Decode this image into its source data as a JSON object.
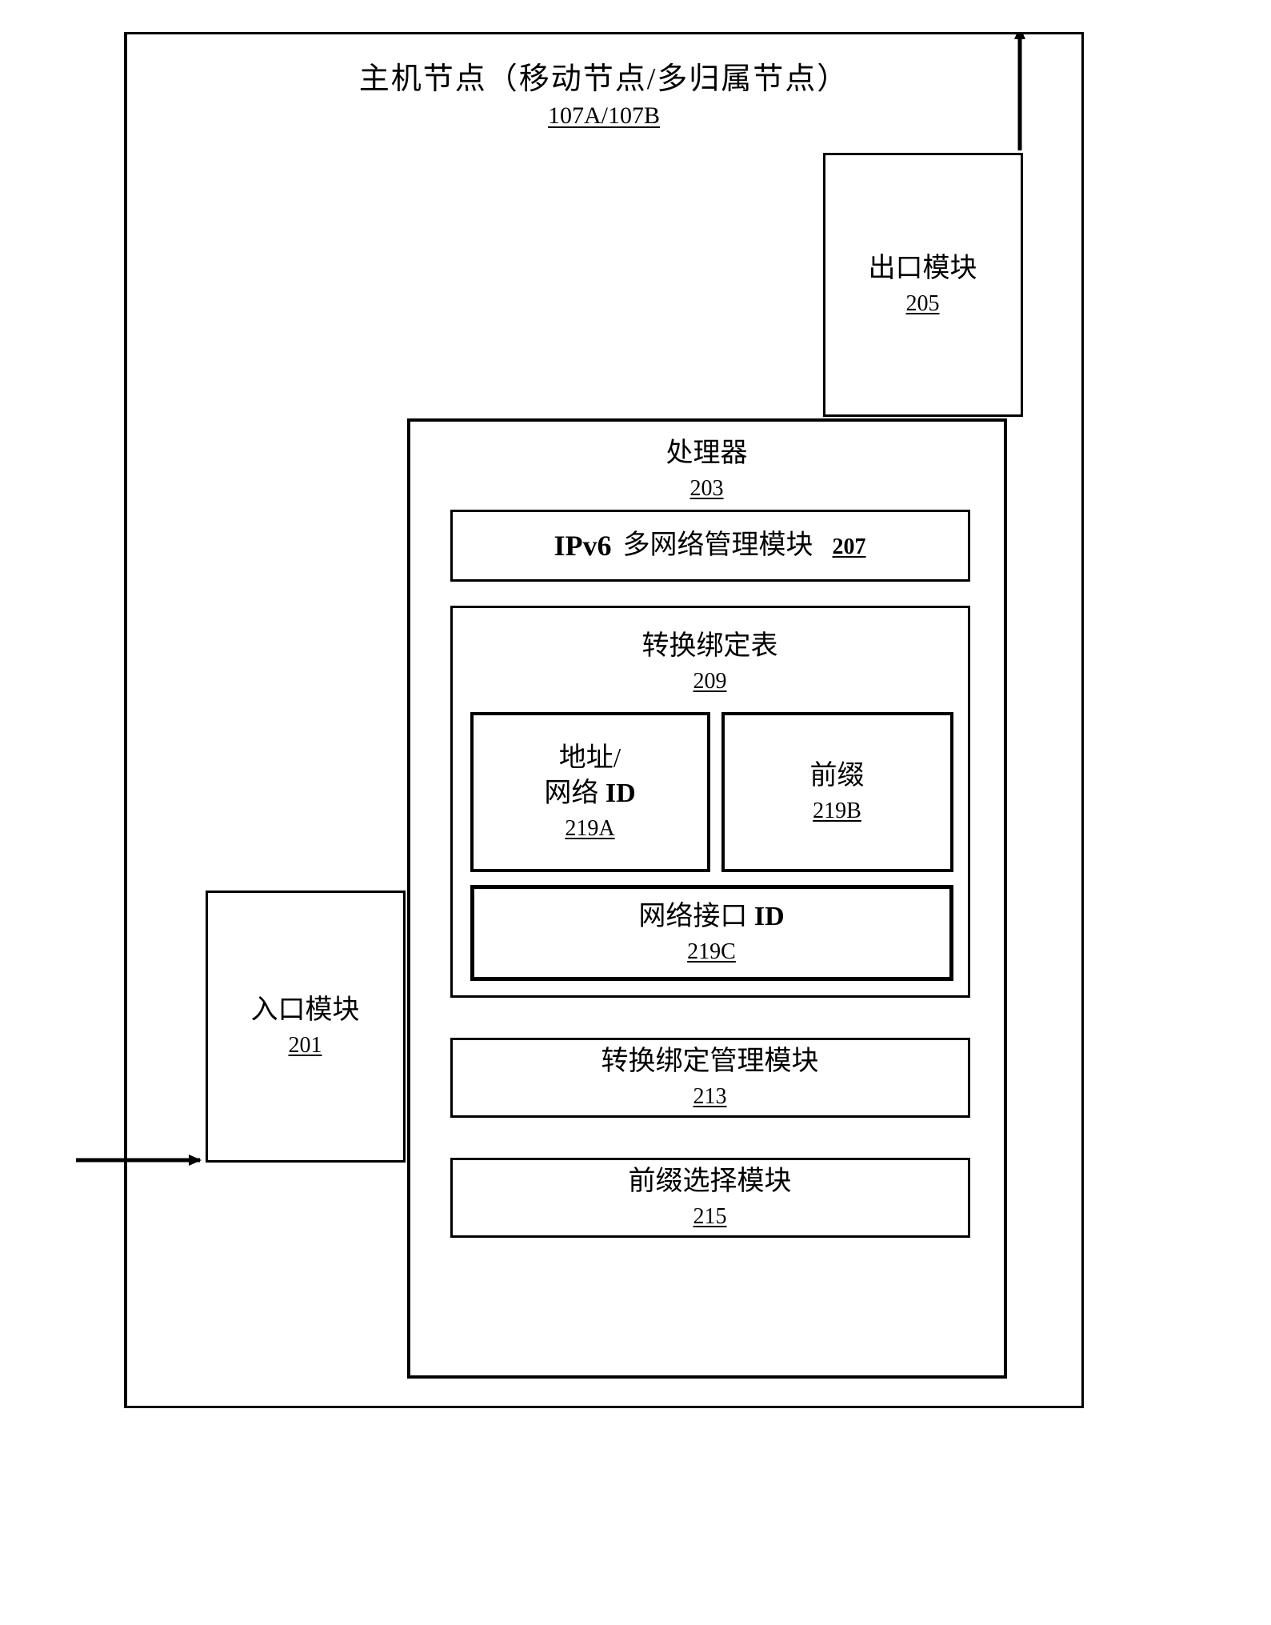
{
  "host": {
    "title": "主机节点（移动节点/多归属节点）",
    "ref": "107A/107B"
  },
  "ingress": {
    "label": "入口模块",
    "ref": "201"
  },
  "egress": {
    "label": "出口模块",
    "ref": "205"
  },
  "processor": {
    "label": "处理器",
    "ref": "203"
  },
  "ipv6_module": {
    "label_prefix": "IPv6",
    "label_suffix": "多网络管理模块",
    "ref": "207"
  },
  "binding_table": {
    "label": "转换绑定表",
    "ref": "209"
  },
  "address_id": {
    "line1": "地址/",
    "line2": "网络",
    "bold_id": "ID",
    "ref": "219A"
  },
  "prefix_small": {
    "label": "前缀",
    "ref": "219B"
  },
  "interface_id": {
    "label_cn": "网络接口",
    "label_id": "ID",
    "ref": "219C"
  },
  "binding_mgmt": {
    "label": "转换绑定管理模块",
    "ref": "213"
  },
  "prefix_select": {
    "label": "前缀选择模块",
    "ref": "215"
  }
}
